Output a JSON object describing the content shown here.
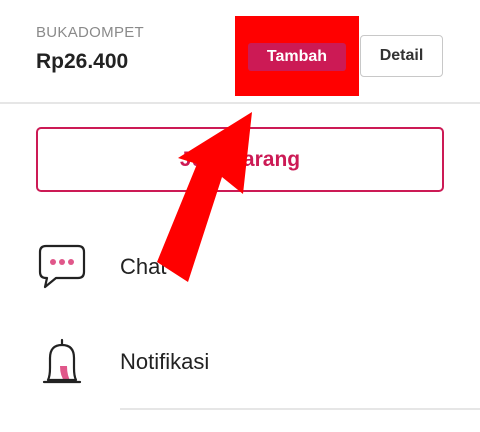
{
  "wallet": {
    "label": "BUKADOMPET",
    "balance": "Rp26.400",
    "tambah_label": "Tambah",
    "detail_label": "Detail"
  },
  "sell_button": {
    "label": "Jual Barang"
  },
  "menu": [
    {
      "label": "Chat",
      "icon": "chat-bubble-icon"
    },
    {
      "label": "Notifikasi",
      "icon": "bell-icon"
    }
  ],
  "colors": {
    "brand": "#cc1a55",
    "highlight": "#ff0000",
    "text": "#222222",
    "muted": "#8a8a8a",
    "divider": "#e6e6e6"
  }
}
